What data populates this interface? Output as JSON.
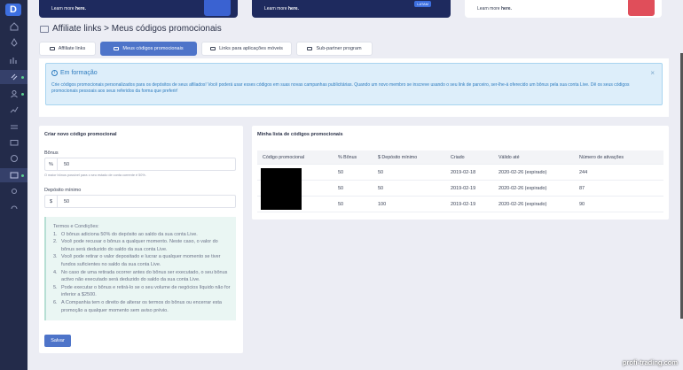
{
  "banners": [
    {
      "text": "Learn more ",
      "link": "here."
    },
    {
      "text": "Learn more ",
      "link": "here.",
      "badge": "LATAM"
    },
    {
      "text": "Learn more ",
      "link": "here."
    }
  ],
  "page": {
    "title": "Affiliate links > Meus códigos promocionais"
  },
  "tabs": [
    "Affiliate links",
    "Meus códigos promocionais",
    "Links para aplicações móveis",
    "Sub-partner program"
  ],
  "info": {
    "title": "Em formação",
    "text": "Crie códigos promocionais personalizados para os depósitos de seus afiliados! Você poderá usar esses códigos em suas novas campanhas publicitárias. Quando um novo membro se inscreve usando o seu link de parceiro, ser-lhe-á oferecido um bônus pela sua conta Live. Dê os seus códigos promocionais pessoais aos seus referidos da forma que preferir!",
    "close": "×"
  },
  "create": {
    "header": "Criar novo código promocional",
    "bonus_label": "Bônus",
    "bonus_prefix": "%",
    "bonus_value": "50",
    "hint": "O maior bônus possível para o seu estado de conta corrente é 50%.",
    "deposit_label": "Depósito mínimo",
    "deposit_prefix": "$",
    "deposit_value": "50",
    "terms_title": "Termos e Condições:",
    "terms": [
      {
        "n": "1.",
        "t": "O bônus adiciona 50% do depósito ao saldo da sua conta Live."
      },
      {
        "n": "2.",
        "t": "Você pode recusar o bônus a qualquer momento. Neste caso, o valor do bônus será deduzido do saldo da sua conta Live."
      },
      {
        "n": "3.",
        "t": "Você pode retirar o valor depositado e lucrar a qualquer momento se tiver fundos suficientes no saldo da sua conta Live."
      },
      {
        "n": "4.",
        "t": "No caso de uma retirada ocorrer antes do bônus ser executado, o seu bônus activo não executado será deduzido do saldo da sua conta Live."
      },
      {
        "n": "5.",
        "t": "Pode executar o bônus e retirá-lo se o seu volume de negócios líquido não for inferior a $2500."
      },
      {
        "n": "6.",
        "t": "A Companhia tem o direito de alterar os termos do bônus ou encerrar esta promoção a qualquer momento sem aviso prévio."
      }
    ],
    "save": "Salvar"
  },
  "list": {
    "header": "Minha lista de códigos promocionais",
    "columns": [
      "Código promocional",
      "% Bônus",
      "$ Depósito mínimo",
      "Criado",
      "Válido até",
      "Número de ativações"
    ],
    "rows": [
      {
        "bonus": "50",
        "deposit": "50",
        "created": "2019-02-18",
        "valid": "2020-02-26 (expirado)",
        "activations": "244"
      },
      {
        "bonus": "50",
        "deposit": "50",
        "created": "2019-02-19",
        "valid": "2020-02-26 (expirado)",
        "activations": "87"
      },
      {
        "bonus": "50",
        "deposit": "100",
        "created": "2019-02-19",
        "valid": "2020-02-26 (expirado)",
        "activations": "90"
      }
    ]
  },
  "watermark": "profi-trading.com",
  "colors": {
    "sidebar": "#232b4a",
    "accent": "#4e74c9",
    "info_bg": "#ddeefa",
    "info_text": "#2e7cbf"
  },
  "icons": {
    "sidebar": [
      "home-icon",
      "rocket-icon",
      "chart-icon",
      "link-icon",
      "user-icon",
      "trend-icon",
      "transfer-icon",
      "wallet-icon",
      "stats-icon",
      "card-icon",
      "settings-icon",
      "support-icon"
    ]
  }
}
